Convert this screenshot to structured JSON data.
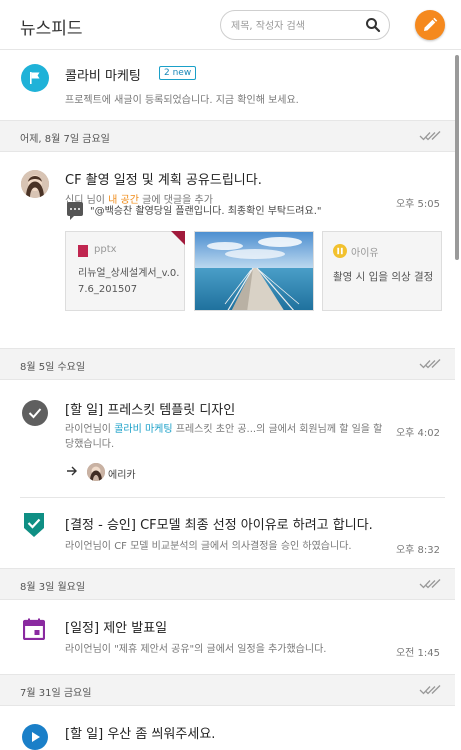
{
  "header": {
    "title": "뉴스피드",
    "search_placeholder": "제목, 작성자 검색",
    "search_icon": "search-icon",
    "compose_icon": "pencil-icon",
    "accent": "#f5891e"
  },
  "project": {
    "name": "콜라비 마케팅",
    "new_badge": "2 new",
    "description": "프로젝트에 새글이 등록되었습니다. 지금 확인해 보세요.",
    "icon": "flag-icon",
    "color": "#1fb2d8"
  },
  "groups": [
    {
      "date": "어제, 8월 7일 금요일",
      "posts": [
        {
          "title": "CF 촬영 일정 및 계획 공유드립니다.",
          "author": "신디",
          "meta_mid": " 님이 ",
          "highlight": "내 공간",
          "meta_end": " 글에 댓글을 추가",
          "time": "오후 5:05",
          "comment": "\"@백승찬 촬영당일 플랜입니다. 최종확인 부탁드려요.\"",
          "attachments": [
            {
              "type": "pptx",
              "name": "리뉴얼_상세설계서_v.0.7.6_201507"
            },
            {
              "type": "image",
              "name": "pier-photo"
            },
            {
              "type": "idea",
              "label": "아이유",
              "name": "촬영 시 입을 의상 결정"
            }
          ]
        }
      ]
    },
    {
      "date": "8월 5일 수요일",
      "posts": [
        {
          "title": "[할 일] 프레스킷 템플릿 디자인",
          "author": "라이언",
          "meta_mid": "님이 ",
          "highlight": "콜라비 마케팅",
          "meta_end": " 프레스킷 초안 공...의 글에서 회원님께 할 일을 할당했습니다.",
          "time": "오후 4:02",
          "assignee": "에리카"
        },
        {
          "title": "[결정 - 승인] CF모델 최종 선정 아이유로 하려고 합니다.",
          "author": "라이언",
          "meta_end": "님이 CF 모델 비교분석의 글에서 의사결정을 승인 하였습니다.",
          "time": "오후 8:32"
        }
      ]
    },
    {
      "date": "8월 3일 월요일",
      "posts": [
        {
          "title": "[일정] 제안 발표일",
          "author": "라이언",
          "meta_end": "님이 \"제휴 제안서 공유\"의 글에서 일정을 추가했습니다.",
          "time": "오전 1:45"
        }
      ]
    },
    {
      "date": "7월 31일 금요일",
      "posts": [
        {
          "title": "[할 일] 우산 좀 씌워주세요."
        }
      ]
    }
  ]
}
